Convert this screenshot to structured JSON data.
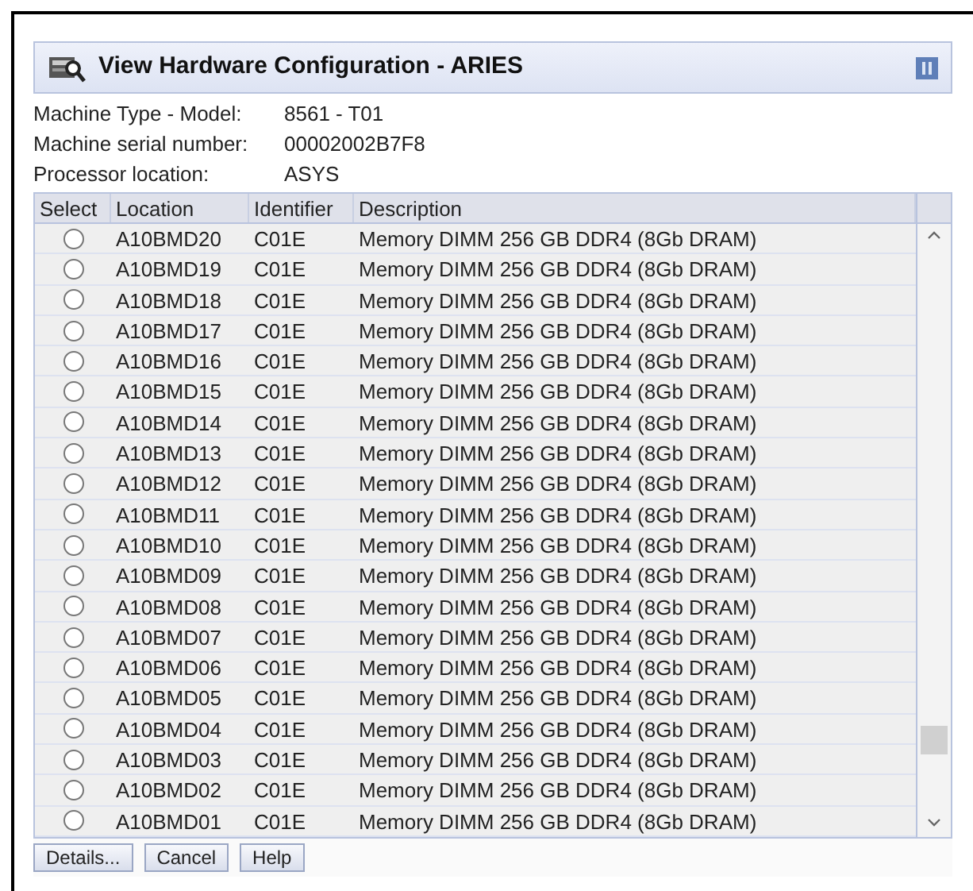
{
  "window": {
    "title": "View Hardware Configuration - ARIES"
  },
  "info": [
    {
      "label": "Machine Type - Model:",
      "value": "8561 - T01"
    },
    {
      "label": "Machine serial number:",
      "value": "00002002B7F8"
    },
    {
      "label": "Processor location:",
      "value": "ASYS"
    }
  ],
  "table": {
    "columns": [
      "Select",
      "Location",
      "Identifier",
      "Description"
    ],
    "rows": [
      {
        "selected": false,
        "location": "A10BMD20",
        "identifier": "C01E",
        "description": "Memory DIMM 256 GB DDR4 (8Gb DRAM)"
      },
      {
        "selected": false,
        "location": "A10BMD19",
        "identifier": "C01E",
        "description": "Memory DIMM 256 GB DDR4 (8Gb DRAM)"
      },
      {
        "selected": false,
        "location": "A10BMD18",
        "identifier": "C01E",
        "description": "Memory DIMM 256 GB DDR4 (8Gb DRAM)"
      },
      {
        "selected": false,
        "location": "A10BMD17",
        "identifier": "C01E",
        "description": "Memory DIMM 256 GB DDR4 (8Gb DRAM)"
      },
      {
        "selected": false,
        "location": "A10BMD16",
        "identifier": "C01E",
        "description": "Memory DIMM 256 GB DDR4 (8Gb DRAM)"
      },
      {
        "selected": false,
        "location": "A10BMD15",
        "identifier": "C01E",
        "description": "Memory DIMM 256 GB DDR4 (8Gb DRAM)"
      },
      {
        "selected": false,
        "location": "A10BMD14",
        "identifier": "C01E",
        "description": "Memory DIMM 256 GB DDR4 (8Gb DRAM)"
      },
      {
        "selected": false,
        "location": "A10BMD13",
        "identifier": "C01E",
        "description": "Memory DIMM 256 GB DDR4 (8Gb DRAM)"
      },
      {
        "selected": false,
        "location": "A10BMD12",
        "identifier": "C01E",
        "description": "Memory DIMM 256 GB DDR4 (8Gb DRAM)"
      },
      {
        "selected": false,
        "location": "A10BMD11",
        "identifier": "C01E",
        "description": "Memory DIMM 256 GB DDR4 (8Gb DRAM)"
      },
      {
        "selected": false,
        "location": "A10BMD10",
        "identifier": "C01E",
        "description": "Memory DIMM 256 GB DDR4 (8Gb DRAM)"
      },
      {
        "selected": false,
        "location": "A10BMD09",
        "identifier": "C01E",
        "description": "Memory DIMM 256 GB DDR4 (8Gb DRAM)"
      },
      {
        "selected": false,
        "location": "A10BMD08",
        "identifier": "C01E",
        "description": "Memory DIMM 256 GB DDR4 (8Gb DRAM)"
      },
      {
        "selected": false,
        "location": "A10BMD07",
        "identifier": "C01E",
        "description": "Memory DIMM 256 GB DDR4 (8Gb DRAM)"
      },
      {
        "selected": false,
        "location": "A10BMD06",
        "identifier": "C01E",
        "description": "Memory DIMM 256 GB DDR4 (8Gb DRAM)"
      },
      {
        "selected": false,
        "location": "A10BMD05",
        "identifier": "C01E",
        "description": "Memory DIMM 256 GB DDR4 (8Gb DRAM)"
      },
      {
        "selected": false,
        "location": "A10BMD04",
        "identifier": "C01E",
        "description": "Memory DIMM 256 GB DDR4 (8Gb DRAM)"
      },
      {
        "selected": false,
        "location": "A10BMD03",
        "identifier": "C01E",
        "description": "Memory DIMM 256 GB DDR4 (8Gb DRAM)"
      },
      {
        "selected": false,
        "location": "A10BMD02",
        "identifier": "C01E",
        "description": "Memory DIMM 256 GB DDR4 (8Gb DRAM)"
      },
      {
        "selected": false,
        "location": "A10BMD01",
        "identifier": "C01E",
        "description": "Memory DIMM 256 GB DDR4 (8Gb DRAM)"
      }
    ]
  },
  "buttons": [
    "Details...",
    "Cancel",
    "Help"
  ]
}
